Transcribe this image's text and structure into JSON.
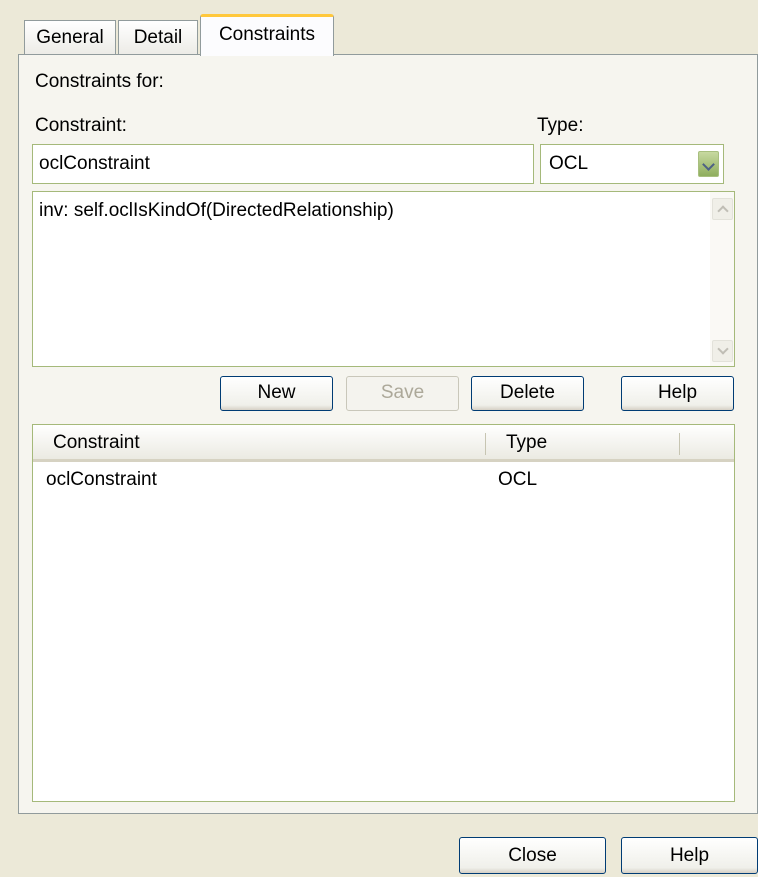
{
  "tabs": [
    {
      "label": "General"
    },
    {
      "label": "Detail"
    },
    {
      "label": "Constraints",
      "active": true
    }
  ],
  "form": {
    "constraints_for_label": "Constraints for:",
    "constraint_label": "Constraint:",
    "type_label": "Type:",
    "constraint_value": "oclConstraint",
    "type_value": "OCL",
    "expression": "inv: self.oclIsKindOf(DirectedRelationship)"
  },
  "buttons": {
    "new": "New",
    "save": "Save",
    "delete": "Delete",
    "help": "Help"
  },
  "table": {
    "columns": [
      "Constraint",
      "Type"
    ],
    "rows": [
      {
        "constraint": "oclConstraint",
        "type": "OCL"
      }
    ]
  },
  "footer": {
    "close": "Close",
    "help": "Help"
  },
  "colors": {
    "background": "#ECE9D8",
    "active_tab_highlight": "#FFC83C",
    "field_border": "#7F9DB9",
    "button_border": "#003C74"
  },
  "icons": {
    "combo": "chevron-down-icon",
    "scroll_up": "scroll-up-icon",
    "scroll_down": "scroll-down-icon"
  }
}
